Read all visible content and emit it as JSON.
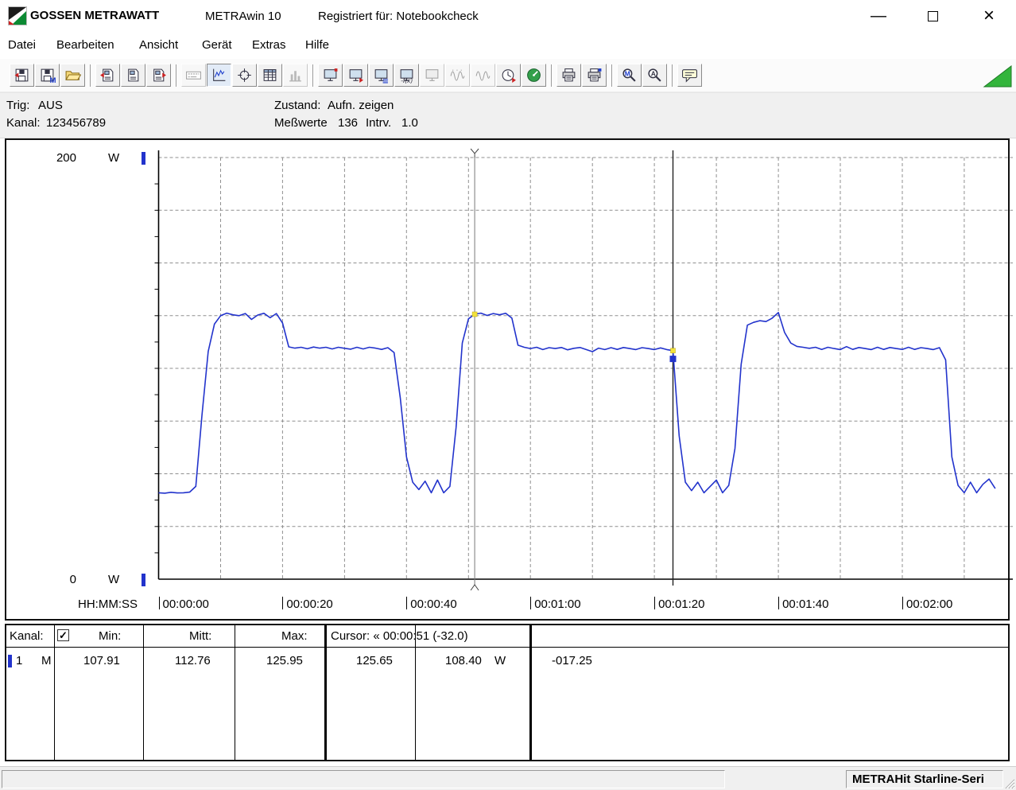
{
  "window": {
    "minimize_glyph": "—",
    "close_glyph": "×"
  },
  "title_bar": {
    "app_name": "GOSSEN METRAWATT",
    "product": "METRAwin 10",
    "registered": "Registriert für: Notebookcheck"
  },
  "menu": {
    "items": [
      "Datei",
      "Bearbeiten",
      "Ansicht",
      "Gerät",
      "Extras",
      "Hilfe"
    ]
  },
  "toolbar_icons": [
    "save-in-icon",
    "save-m-icon",
    "open-folder-icon",
    "read-device-icon",
    "device-memory-icon",
    "write-device-icon",
    "numeric-display-icon",
    "yt-chart-icon",
    "xy-chart-icon",
    "table-view-icon",
    "histogram-icon",
    "monitor-icon",
    "monitor-export-icon",
    "monitor-list-icon",
    "monitor-fx-icon",
    "monitor-offline-icon",
    "wave-points-icon",
    "wave-view-icon",
    "interval-timer-icon",
    "online-gauge-icon",
    "print-icon",
    "print-preview-icon",
    "zoom-m-icon",
    "zoom-a-icon",
    "note-bubble-icon",
    "status-triangle-icon"
  ],
  "status_panel": {
    "trig_label": "Trig:",
    "trig_value": "AUS",
    "kanal_label": "Kanal:",
    "kanal_value": "123456789",
    "zustand_label": "Zustand:",
    "zustand_value": "Aufn. zeigen",
    "messwerte_label": "Meßwerte",
    "messwerte_value": "136",
    "intrv_label": "Intrv.",
    "intrv_value": "1.0"
  },
  "table": {
    "headers": {
      "kanal": "Kanal:",
      "checkbox_glyph": "✓",
      "min": "Min:",
      "mitt": "Mitt:",
      "max": "Max:",
      "cursor": "Cursor: « 00:00:51 (-32.0)"
    },
    "row": {
      "channel": "1",
      "mode": "M",
      "min": "107.91",
      "mitt": "112.76",
      "max": "125.95",
      "cursor1": "125.65",
      "cursor2": "108.40",
      "unit": "W",
      "delta": "-017.25"
    }
  },
  "statusbar": {
    "device": "METRAHit Starline-Seri"
  },
  "chart_data": {
    "type": "line",
    "title": "",
    "ylabel_unit": "W",
    "y_top_label": "200",
    "y_bottom_label": "0",
    "ylim": [
      0,
      200
    ],
    "x_axis_label": "HH:MM:SS",
    "x_ticks": [
      "00:00:00",
      "00:00:20",
      "00:00:40",
      "00:01:00",
      "00:01:20",
      "00:01:40",
      "00:02:00"
    ],
    "x_tick_seconds": [
      0,
      20,
      40,
      60,
      80,
      100,
      120
    ],
    "xlim_seconds": [
      0,
      137
    ],
    "grid": true,
    "sample_count": 136,
    "interval_seconds": 1.0,
    "legend_position": "none",
    "cursors": {
      "c1_seconds": 51,
      "c2_seconds": 83,
      "c1_value": 125.65,
      "c2_value": 108.4,
      "delta_seconds": -32.0,
      "delta_value": -17.25
    },
    "series": [
      {
        "name": "Kanal 1",
        "unit": "W",
        "color": "#2233cc",
        "points": [
          [
            0,
            41
          ],
          [
            1,
            40.8
          ],
          [
            2,
            41.2
          ],
          [
            3,
            40.9
          ],
          [
            4,
            41
          ],
          [
            5,
            41.3
          ],
          [
            6,
            44
          ],
          [
            7,
            78
          ],
          [
            8,
            108
          ],
          [
            9,
            121
          ],
          [
            10,
            125
          ],
          [
            11,
            126.2
          ],
          [
            12,
            125.4
          ],
          [
            13,
            125
          ],
          [
            14,
            126
          ],
          [
            15,
            123.2
          ],
          [
            16,
            125.3
          ],
          [
            17,
            126.1
          ],
          [
            18,
            124
          ],
          [
            19,
            126
          ],
          [
            20,
            121.5
          ],
          [
            21,
            110.2
          ],
          [
            22,
            109.6
          ],
          [
            23,
            110
          ],
          [
            24,
            109.3
          ],
          [
            25,
            110.1
          ],
          [
            26,
            109.6
          ],
          [
            27,
            110
          ],
          [
            28,
            109.2
          ],
          [
            29,
            110
          ],
          [
            30,
            109.5
          ],
          [
            31,
            109.1
          ],
          [
            32,
            110
          ],
          [
            33,
            109.2
          ],
          [
            34,
            110
          ],
          [
            35,
            109.6
          ],
          [
            36,
            109
          ],
          [
            37,
            109.8
          ],
          [
            38,
            107.5
          ],
          [
            39,
            86
          ],
          [
            40,
            58
          ],
          [
            41,
            46
          ],
          [
            42,
            42.5
          ],
          [
            43,
            46.5
          ],
          [
            44,
            41
          ],
          [
            45,
            47
          ],
          [
            46,
            41
          ],
          [
            47,
            44
          ],
          [
            48,
            72
          ],
          [
            49,
            112
          ],
          [
            50,
            123.5
          ],
          [
            51,
            125.65
          ],
          [
            52,
            126.2
          ],
          [
            53,
            125.1
          ],
          [
            54,
            126
          ],
          [
            55,
            125.4
          ],
          [
            56,
            126.1
          ],
          [
            57,
            123.8
          ],
          [
            58,
            111
          ],
          [
            59,
            110
          ],
          [
            60,
            109.4
          ],
          [
            61,
            110
          ],
          [
            62,
            108.9
          ],
          [
            63,
            109.8
          ],
          [
            64,
            109.4
          ],
          [
            65,
            109.9
          ],
          [
            66,
            108.8
          ],
          [
            67,
            109.5
          ],
          [
            68,
            109.9
          ],
          [
            69,
            108.9
          ],
          [
            70,
            107.91
          ],
          [
            71,
            109.6
          ],
          [
            72,
            108.9
          ],
          [
            73,
            109.8
          ],
          [
            74,
            109
          ],
          [
            75,
            109.9
          ],
          [
            76,
            109.4
          ],
          [
            77,
            108.9
          ],
          [
            78,
            109.8
          ],
          [
            79,
            109.4
          ],
          [
            80,
            108.9
          ],
          [
            81,
            109.7
          ],
          [
            82,
            108.9
          ],
          [
            83,
            108.4
          ],
          [
            84,
            68
          ],
          [
            85,
            46
          ],
          [
            86,
            42
          ],
          [
            87,
            46
          ],
          [
            88,
            41
          ],
          [
            89,
            44
          ],
          [
            90,
            47
          ],
          [
            91,
            41
          ],
          [
            92,
            44.5
          ],
          [
            93,
            62
          ],
          [
            94,
            102
          ],
          [
            95,
            120.5
          ],
          [
            96,
            121.8
          ],
          [
            97,
            122.6
          ],
          [
            98,
            122.2
          ],
          [
            99,
            123.8
          ],
          [
            100,
            126.5
          ],
          [
            101,
            117
          ],
          [
            102,
            112
          ],
          [
            103,
            110.4
          ],
          [
            104,
            110
          ],
          [
            105,
            109.5
          ],
          [
            106,
            110
          ],
          [
            107,
            109
          ],
          [
            108,
            110
          ],
          [
            109,
            109.4
          ],
          [
            110,
            108.9
          ],
          [
            111,
            110.3
          ],
          [
            112,
            109
          ],
          [
            113,
            109.9
          ],
          [
            114,
            109.4
          ],
          [
            115,
            108.9
          ],
          [
            116,
            110
          ],
          [
            117,
            109
          ],
          [
            118,
            109.9
          ],
          [
            119,
            109.4
          ],
          [
            120,
            109
          ],
          [
            121,
            110
          ],
          [
            122,
            109
          ],
          [
            123,
            109.8
          ],
          [
            124,
            109.4
          ],
          [
            125,
            108.9
          ],
          [
            126,
            109.8
          ],
          [
            127,
            104
          ],
          [
            128,
            58
          ],
          [
            129,
            44.5
          ],
          [
            130,
            41
          ],
          [
            131,
            46
          ],
          [
            132,
            41
          ],
          [
            133,
            45
          ],
          [
            134,
            47.5
          ],
          [
            135,
            43
          ]
        ]
      }
    ]
  }
}
